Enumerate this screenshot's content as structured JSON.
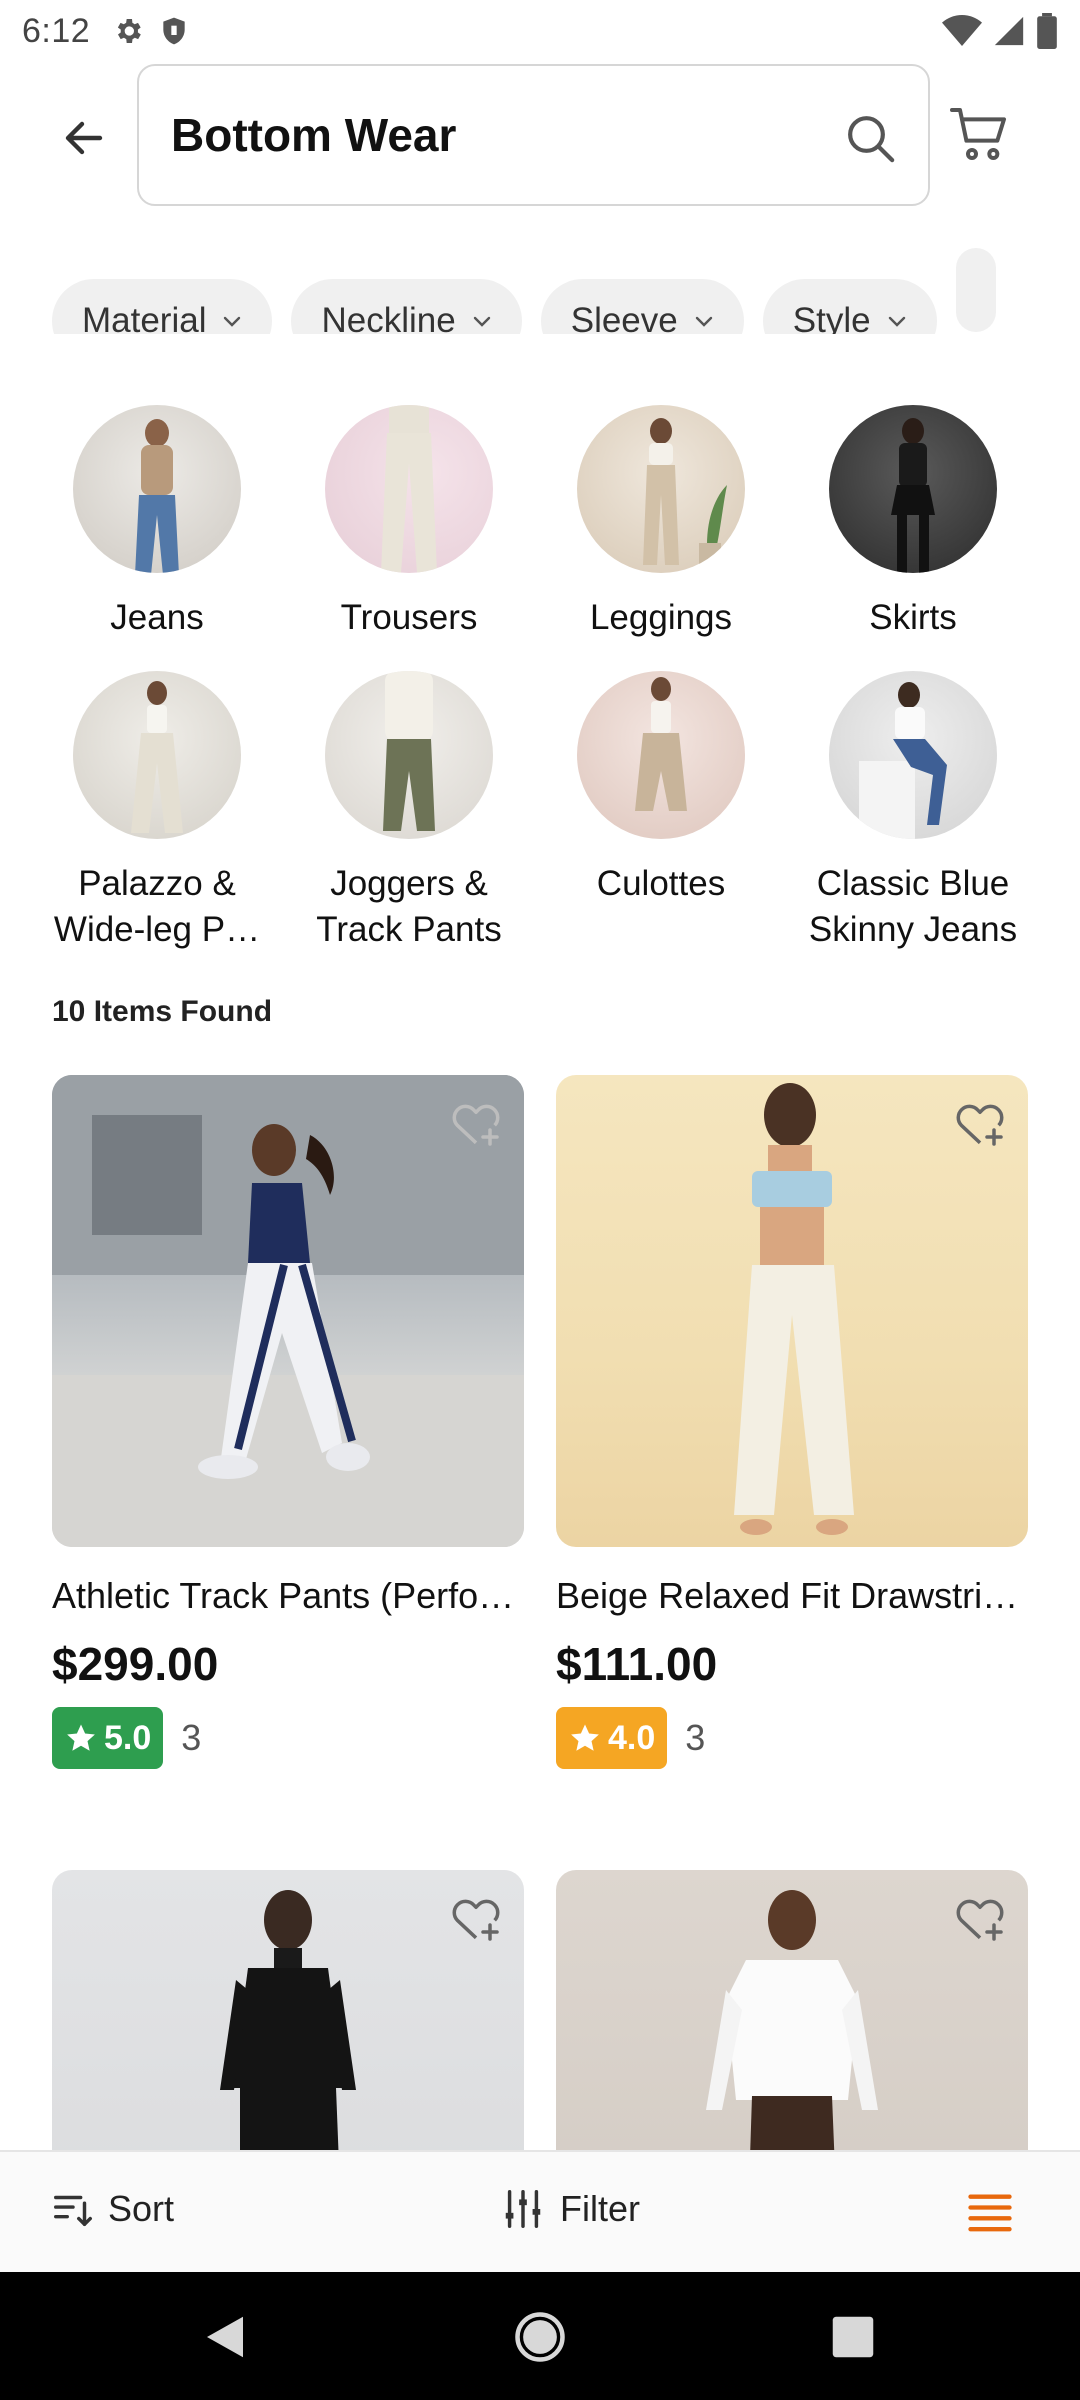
{
  "status_bar": {
    "time": "6:12"
  },
  "header": {
    "search_query": "Bottom Wear"
  },
  "filters": [
    {
      "label": "Material"
    },
    {
      "label": "Neckline"
    },
    {
      "label": "Sleeve"
    },
    {
      "label": "Style"
    }
  ],
  "categories": [
    {
      "label": "Jeans"
    },
    {
      "label": "Trousers"
    },
    {
      "label": "Leggings"
    },
    {
      "label": "Skirts"
    },
    {
      "label": "Palazzo & Wide-leg P…"
    },
    {
      "label": "Joggers & Track Pants"
    },
    {
      "label": "Culottes"
    },
    {
      "label": "Classic Blue Skinny Jeans"
    }
  ],
  "results": {
    "count_text": "10 Items Found"
  },
  "products": [
    {
      "name": "Athletic Track Pants (Perfo…",
      "price": "$299.00",
      "rating": "5.0",
      "reviews": "3",
      "badge_color": "#2e9e4f"
    },
    {
      "name": "Beige Relaxed Fit Drawstrin…",
      "price": "$111.00",
      "rating": "4.0",
      "reviews": "3",
      "badge_color": "#f5a623"
    }
  ],
  "bottom_bar": {
    "sort_label": "Sort",
    "filter_label": "Filter"
  },
  "colors": {
    "accent": "#e8680c",
    "rating_high": "#2e9e4f",
    "rating_mid": "#f5a623"
  }
}
